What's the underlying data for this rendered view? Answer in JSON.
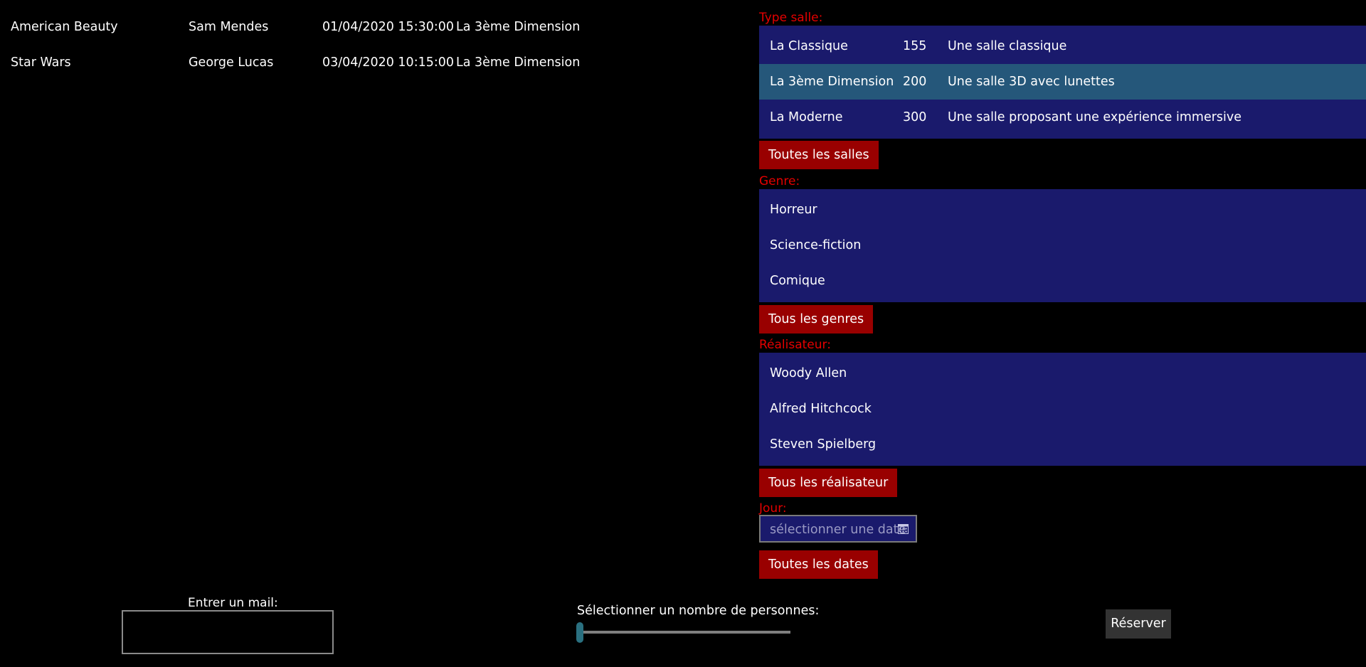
{
  "sessions": [
    {
      "title": "American Beauty",
      "director": "Sam Mendes",
      "datetime": "01/04/2020 15:30:00",
      "room": "La 3ème Dimension"
    },
    {
      "title": "Star Wars",
      "director": "George Lucas",
      "datetime": "03/04/2020 10:15:00",
      "room": "La 3ème Dimension"
    }
  ],
  "room_type": {
    "label": "Type salle:",
    "rooms": [
      {
        "name": "La Classique",
        "capacity": "155",
        "description": "Une salle classique"
      },
      {
        "name": "La 3ème Dimension",
        "capacity": "200",
        "description": "Une salle 3D avec lunettes",
        "selected": true
      },
      {
        "name": "La Moderne",
        "capacity": "300",
        "description": "Une salle proposant une expérience immersive"
      }
    ],
    "reset_label": "Toutes les salles"
  },
  "genre": {
    "label": "Genre:",
    "items": [
      "Horreur",
      "Science-fiction",
      "Comique"
    ],
    "reset_label": "Tous les genres"
  },
  "director": {
    "label": "Réalisateur:",
    "items": [
      "Woody Allen",
      "Alfred Hitchcock",
      "Steven Spielberg"
    ],
    "reset_label": "Tous les réalisateur"
  },
  "day": {
    "label": "Jour:",
    "placeholder": "sélectionner une date",
    "icon": "calendar-icon",
    "reset_label": "Toutes les dates"
  },
  "booking": {
    "mail_label": "Entrer un mail:",
    "mail_value": "",
    "people_label": "Sélectionner un nombre de personnes:",
    "people_value": 0,
    "reserve_label": "Réserver"
  },
  "colors": {
    "background": "#000000",
    "list_background": "#1a1a6c",
    "selected_row": "#25577a",
    "accent_red": "#990000",
    "label_red": "#e50000",
    "slider_thumb": "#2a7080"
  }
}
